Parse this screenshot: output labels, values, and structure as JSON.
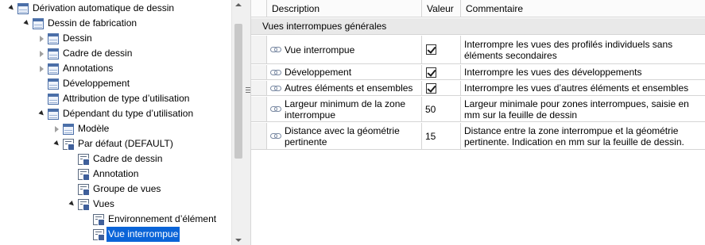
{
  "tree": {
    "items": [
      {
        "label": "Dérivation automatique de dessin",
        "depth": 0,
        "toggle": "expanded",
        "icon": "table",
        "selected": false
      },
      {
        "label": "Dessin de fabrication",
        "depth": 1,
        "toggle": "expanded",
        "icon": "table",
        "selected": false
      },
      {
        "label": "Dessin",
        "depth": 2,
        "toggle": "collapsed",
        "icon": "table",
        "selected": false
      },
      {
        "label": "Cadre de dessin",
        "depth": 2,
        "toggle": "collapsed",
        "icon": "table",
        "selected": false
      },
      {
        "label": "Annotations",
        "depth": 2,
        "toggle": "collapsed",
        "icon": "table",
        "selected": false
      },
      {
        "label": "Développement",
        "depth": 2,
        "toggle": "none",
        "icon": "table",
        "selected": false
      },
      {
        "label": "Attribution de type d’utilisation",
        "depth": 2,
        "toggle": "none",
        "icon": "table",
        "selected": false
      },
      {
        "label": "Dépendant du type d’utilisation",
        "depth": 2,
        "toggle": "expanded",
        "icon": "table",
        "selected": false
      },
      {
        "label": "Modèle",
        "depth": 3,
        "toggle": "collapsed",
        "icon": "table",
        "selected": false
      },
      {
        "label": "Par défaut (DEFAULT)",
        "depth": 3,
        "toggle": "expanded",
        "icon": "page",
        "selected": false
      },
      {
        "label": "Cadre de dessin",
        "depth": 4,
        "toggle": "none",
        "icon": "page",
        "selected": false
      },
      {
        "label": "Annotation",
        "depth": 4,
        "toggle": "none",
        "icon": "page",
        "selected": false
      },
      {
        "label": "Groupe de vues",
        "depth": 4,
        "toggle": "none",
        "icon": "page",
        "selected": false
      },
      {
        "label": "Vues",
        "depth": 4,
        "toggle": "expanded",
        "icon": "page",
        "selected": false
      },
      {
        "label": "Environnement d’élément",
        "depth": 5,
        "toggle": "none",
        "icon": "page",
        "selected": false
      },
      {
        "label": "Vue interrompue",
        "depth": 5,
        "toggle": "none",
        "icon": "page",
        "selected": true
      }
    ]
  },
  "grid": {
    "headers": {
      "description": "Description",
      "value": "Valeur",
      "comment": "Commentaire"
    },
    "group_title": "Vues interrompues générales",
    "rows": [
      {
        "description": "Vue interrompue",
        "value_type": "checkbox",
        "checked": true,
        "value": "",
        "comment": "Interrompre les vues des profilés individuels sans éléments secondaires"
      },
      {
        "description": "Développement",
        "value_type": "checkbox",
        "checked": true,
        "value": "",
        "comment": "Interrompre les vues des développements"
      },
      {
        "description": "Autres éléments et ensembles",
        "value_type": "checkbox",
        "checked": true,
        "value": "",
        "comment": "Interrompre les vues d’autres éléments et ensembles"
      },
      {
        "description": "Largeur minimum de la zone interrompue",
        "value_type": "text",
        "checked": false,
        "value": "50",
        "comment": "Largeur minimale pour zones interrompues, saisie en mm sur la feuille de dessin"
      },
      {
        "description": "Distance avec la géométrie pertinente",
        "value_type": "text",
        "checked": false,
        "value": "15",
        "comment": "Distance entre la zone interrompue et la géométrie pertinente. Indication en mm sur la feuille de dessin."
      }
    ]
  },
  "colors": {
    "selection": "#0a64d8",
    "group_band": "#e9e9e9",
    "grid_line": "#d5d5d5"
  }
}
